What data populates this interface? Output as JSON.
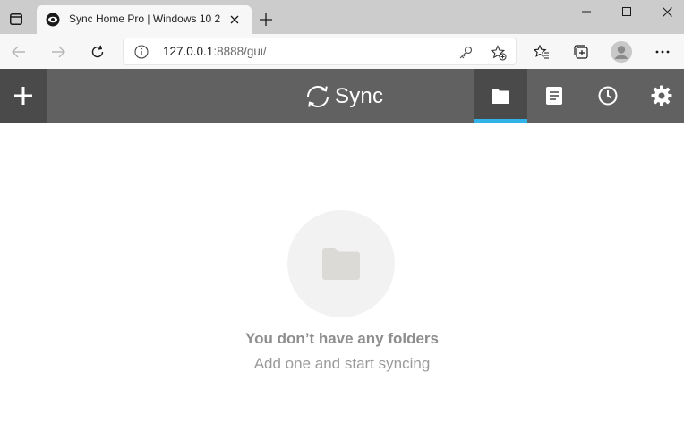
{
  "browser": {
    "tab": {
      "title": "Sync Home Pro | Windows 10 2",
      "favicon": "sync-eye-icon"
    },
    "address": {
      "host": "127.0.0.1",
      "path": ":8888/gui/"
    },
    "icons": [
      "window-menu-icon",
      "close-icon",
      "plus-icon",
      "minimize-icon",
      "maximize-icon",
      "back-icon",
      "forward-icon",
      "reload-icon",
      "info-icon",
      "key-icon",
      "add-favorite-icon",
      "favorites-icon",
      "collections-icon",
      "profile-icon",
      "more-icon"
    ]
  },
  "app": {
    "brand": "Sync",
    "tabs": [
      {
        "name": "folders",
        "icon": "folder-icon",
        "active": true
      },
      {
        "name": "transfers",
        "icon": "document-icon",
        "active": false
      },
      {
        "name": "history",
        "icon": "clock-icon",
        "active": false
      },
      {
        "name": "settings",
        "icon": "gear-icon",
        "active": false
      }
    ],
    "colors": {
      "header": "#616161",
      "header_dark": "#4a4a4a",
      "accent": "#2fb3e8"
    }
  },
  "empty_state": {
    "icon": "folder-icon",
    "title": "You don’t have any folders",
    "subtitle": "Add one and start syncing"
  }
}
